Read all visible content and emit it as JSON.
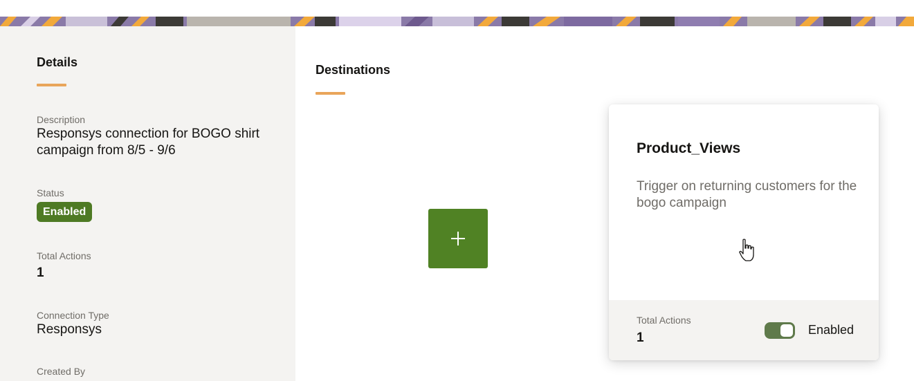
{
  "details": {
    "heading": "Details",
    "description_label": "Description",
    "description_value": "Responsys connection for BOGO shirt campaign from 8/5 - 9/6",
    "status_label": "Status",
    "status_value": "Enabled",
    "total_actions_label": "Total Actions",
    "total_actions_value": "1",
    "connection_type_label": "Connection Type",
    "connection_type_value": "Responsys",
    "created_by_label": "Created By"
  },
  "destinations": {
    "heading": "Destinations",
    "add_button_icon": "plus-icon",
    "card": {
      "title": "Product_Views",
      "description": "Trigger on returning customers for the bogo campaign",
      "total_actions_label": "Total Actions",
      "total_actions_value": "1",
      "toggle_label": "Enabled",
      "toggle_on": true
    }
  },
  "colors": {
    "accent": "#e9a55a",
    "success": "#508224",
    "panel_bg": "#f4f3f1"
  }
}
